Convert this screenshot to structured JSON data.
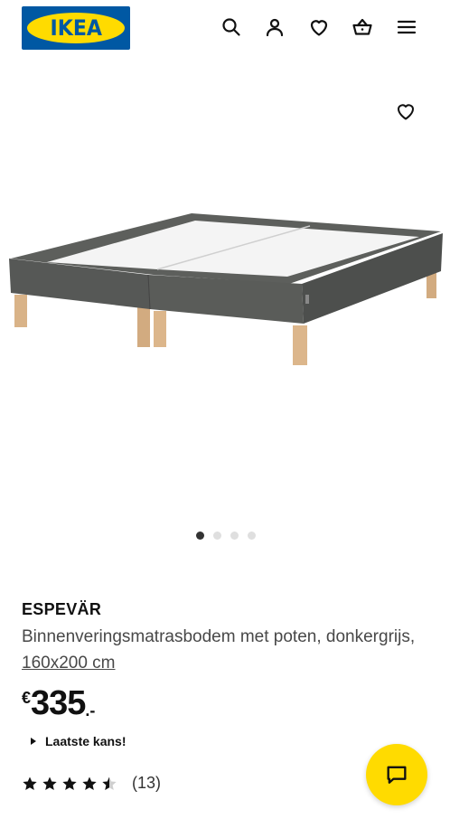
{
  "header": {
    "logo_text": "IKEA",
    "icons": [
      "search-icon",
      "account-icon",
      "heart-icon",
      "basket-icon",
      "menu-icon"
    ]
  },
  "gallery": {
    "image_alt": "ESPEVÄR",
    "dot_count": 4,
    "active_dot": 1
  },
  "product": {
    "name": "ESPEVÄR",
    "description": "Binnenveringsmatrasbodem met poten, donkergrijs, ",
    "size_link": "160x200 cm"
  },
  "price": {
    "currency": "€",
    "integer": "335",
    "decimal": ".-"
  },
  "notice": {
    "text": "Laatste kans!"
  },
  "rating": {
    "stars": 4.5,
    "max": 5,
    "count": "(13)"
  },
  "colors": {
    "brand_blue": "#0058a3",
    "brand_yellow": "#ffdb00",
    "text": "#111111",
    "muted": "#484848"
  }
}
